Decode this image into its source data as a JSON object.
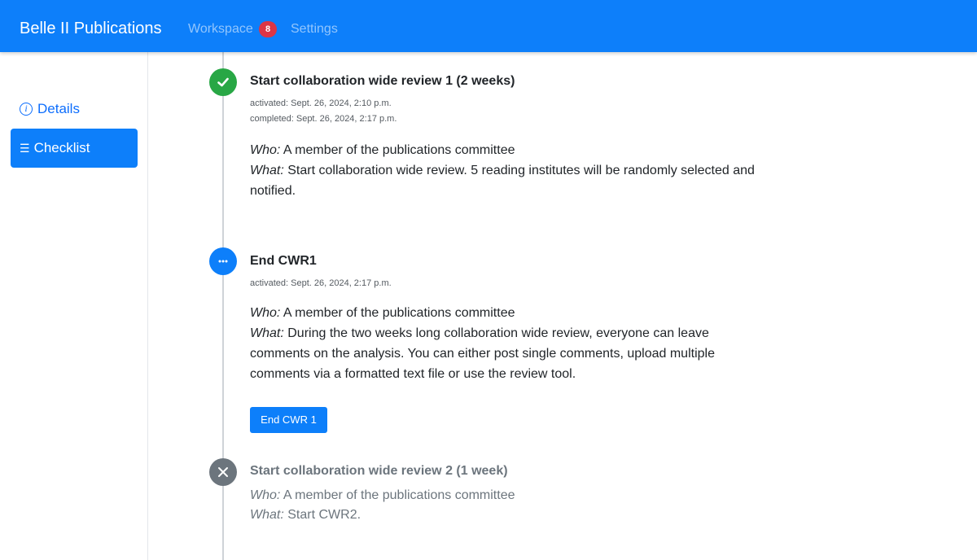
{
  "navbar": {
    "brand": "Belle II Publications",
    "workspace_label": "Workspace",
    "workspace_badge": "8",
    "settings_label": "Settings",
    "accent_color": "#0d7ffa",
    "badge_color": "#dc3545"
  },
  "sidebar": {
    "items": [
      {
        "label": "Details",
        "icon": "info-icon",
        "active": false
      },
      {
        "label": "Checklist",
        "icon": "list-icon",
        "active": true
      }
    ]
  },
  "steps": [
    {
      "title": "Start collaboration wide review 1 (2 weeks)",
      "status": "completed",
      "status_icon": "check-icon",
      "status_color": "#28a745",
      "activated": "activated: Sept. 26, 2024, 2:10 p.m.",
      "completed": "completed: Sept. 26, 2024, 2:17 p.m.",
      "who_label": "Who:",
      "who": "A member of the publications committee",
      "what_label": "What:",
      "what": "Start collaboration wide review. 5 reading institutes will be randomly selected and notified."
    },
    {
      "title": "End CWR1",
      "status": "in-progress",
      "status_icon": "ellipsis-icon",
      "status_color": "#0d7ffa",
      "activated": "activated: Sept. 26, 2024, 2:17 p.m.",
      "who_label": "Who:",
      "who": "A member of the publications committee",
      "what_label": "What:",
      "what": "During the two weeks long collaboration wide review, everyone can leave comments on the analysis. You can either post single comments, upload multiple comments via a formatted text file or use the review tool.",
      "action_label": "End CWR 1"
    },
    {
      "title": "Start collaboration wide review 2 (1 week)",
      "status": "skipped",
      "status_icon": "x-icon",
      "status_color": "#6c757d",
      "who_label": "Who:",
      "who": "A member of the publications committee",
      "what_label": "What:",
      "what": "Start CWR2."
    }
  ]
}
